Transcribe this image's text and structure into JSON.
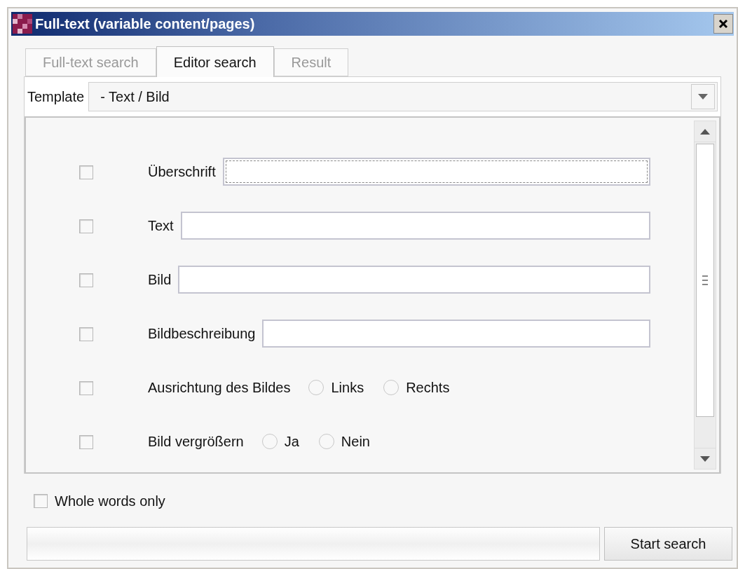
{
  "window": {
    "title": "Full-text (variable content/pages)"
  },
  "tabs": [
    {
      "label": "Full-text search",
      "selected": false
    },
    {
      "label": "Editor search",
      "selected": true
    },
    {
      "label": "Result",
      "selected": false
    }
  ],
  "template": {
    "label": "Template",
    "value": "- Text / Bild"
  },
  "rows": [
    {
      "kind": "field",
      "label": "Überschrift",
      "checked": false,
      "focused": true
    },
    {
      "kind": "field",
      "label": "Text",
      "checked": false,
      "focused": false
    },
    {
      "kind": "field",
      "label": "Bild",
      "checked": false,
      "focused": false
    },
    {
      "kind": "field",
      "label": "Bildbeschreibung",
      "checked": false,
      "focused": false
    },
    {
      "kind": "radio",
      "label": "Ausrichtung des Bildes",
      "checked": false,
      "options": [
        {
          "label": "Links",
          "selected": false
        },
        {
          "label": "Rechts",
          "selected": false
        }
      ]
    },
    {
      "kind": "radio",
      "label": "Bild vergrößern",
      "checked": false,
      "options": [
        {
          "label": "Ja",
          "selected": false
        },
        {
          "label": "Nein",
          "selected": false
        }
      ]
    }
  ],
  "whole_words": {
    "label": "Whole words only",
    "checked": false
  },
  "search_button": "Start search"
}
